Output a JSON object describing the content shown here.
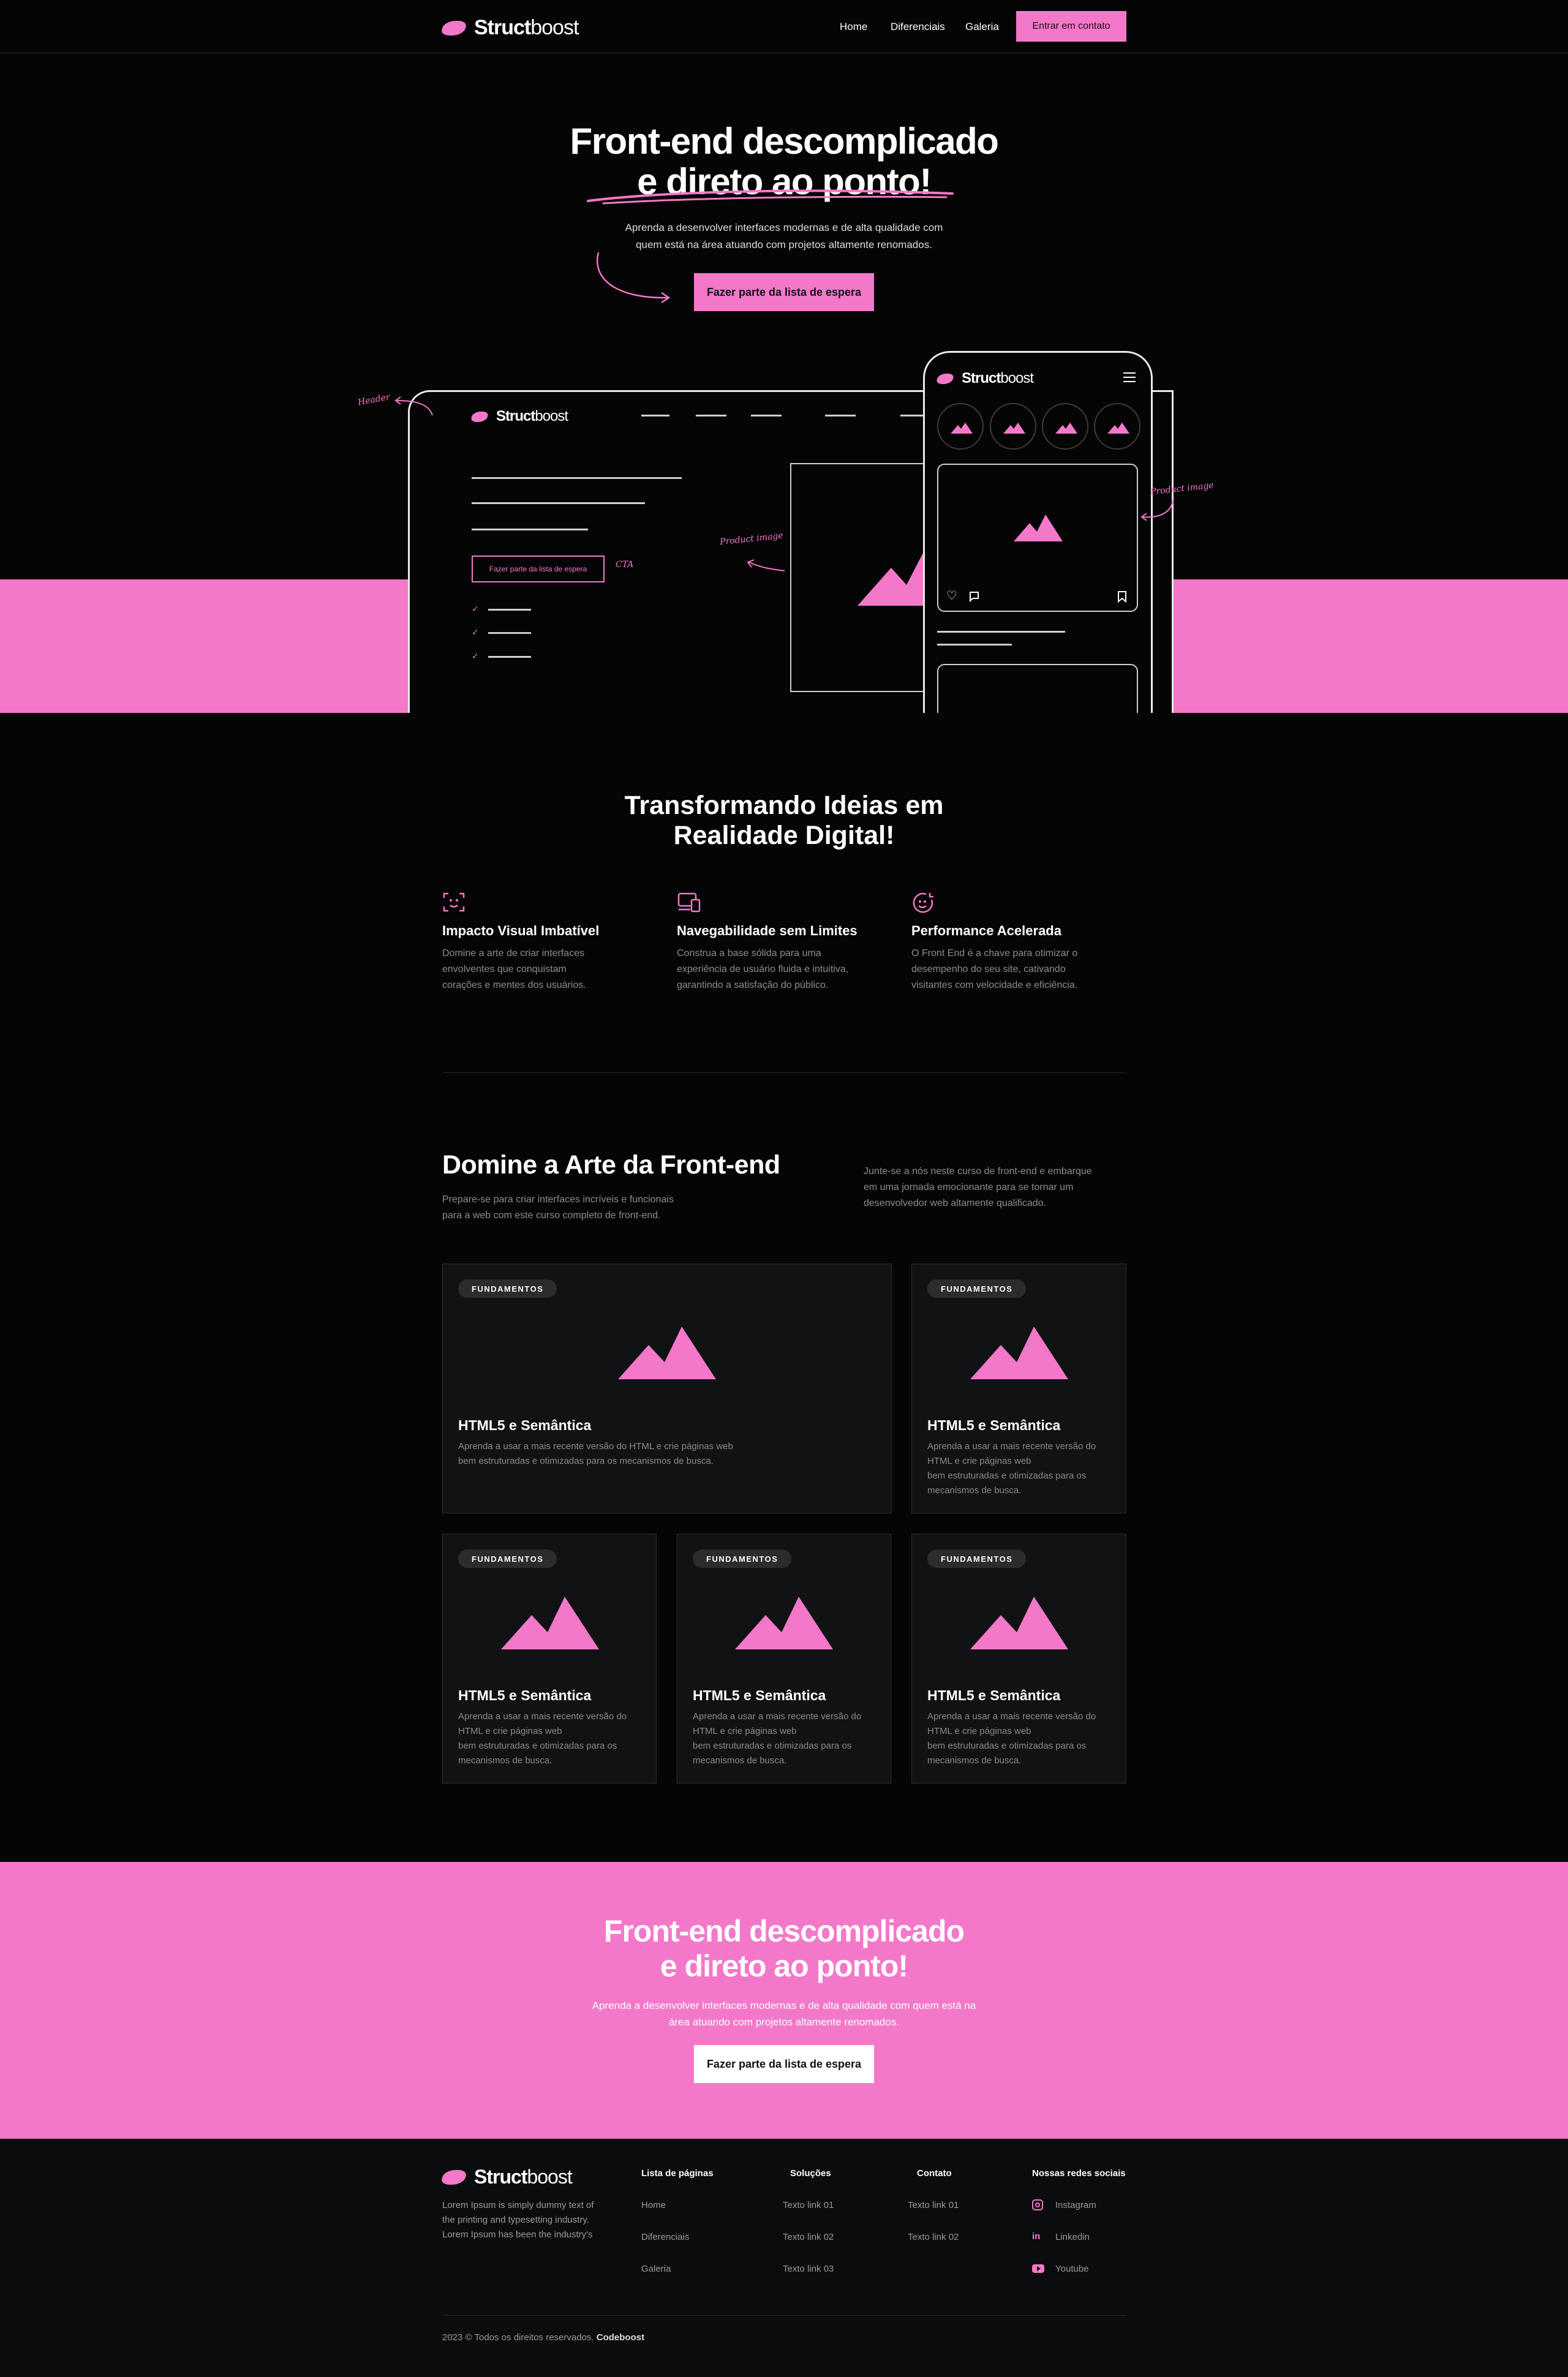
{
  "nav": {
    "logo_bold": "Struct",
    "logo_light": "boost",
    "links": [
      "Home",
      "Diferenciais",
      "Galeria"
    ],
    "cta": "Entrar em contato"
  },
  "hero": {
    "title_line1": "Front-end descomplicado",
    "title_line2": "e direto ao ponto!",
    "subtitle_line1": "Aprenda a desenvolver interfaces modernas e de alta qualidade com",
    "subtitle_line2": "quem está na área atuando com projetos altamente renomados.",
    "cta": "Fazer parte da lista de espera"
  },
  "mockup": {
    "logo_bold": "Struct",
    "logo_light": "boost",
    "cta": "Fazer parte da lista de espera",
    "notes": {
      "header": "Header",
      "cta": "CTA",
      "product_image_left": "Product image",
      "product_image_right": "Product image"
    }
  },
  "features": {
    "title_line1": "Transformando Ideias em",
    "title_line2": "Realidade Digital!",
    "items": [
      {
        "icon": "face-scan-icon",
        "title": "Impacto Visual Imbatível",
        "lines": [
          "Domine a arte de criar interfaces",
          "envolventes que conquistam",
          "corações e mentes dos usuários."
        ]
      },
      {
        "icon": "devices-icon",
        "title": "Navegabilidade sem Limites",
        "lines": [
          "Construa a base sólida para uma",
          "experiência de usuário fluida e intuitiva,",
          "garantindo a satisfação do público."
        ]
      },
      {
        "icon": "speed-icon",
        "title": "Performance Acelerada",
        "lines": [
          "O Front End é a chave para otimizar o",
          "desempenho do seu site, cativando",
          "visitantes com velocidade e eficiência."
        ]
      }
    ]
  },
  "course": {
    "title": "Domine a Arte da Front-end",
    "sub_line1": "Prepare-se para criar interfaces incríveis e funcionais",
    "sub_line2": "para a web com este curso completo de front-end.",
    "side_line1": "Junte-se a nós neste curso de front-end e embarque",
    "side_line2": "em uma jornada emocionante para se tornar um",
    "side_line3": "desenvolvedor web altamente qualificado.",
    "cards": [
      {
        "badge": "FUNDAMENTOS",
        "title": "HTML5 e Semântica",
        "lines": [
          "Aprenda a usar a mais recente versão do HTML e crie páginas web",
          "bem estruturadas e otimizadas para os mecanismos de busca."
        ]
      },
      {
        "badge": "FUNDAMENTOS",
        "title": "HTML5 e Semântica",
        "lines": [
          "Aprenda a usar a mais recente versão do",
          "HTML e crie páginas web",
          "bem estruturadas e otimizadas para os",
          "mecanismos de busca."
        ]
      },
      {
        "badge": "FUNDAMENTOS",
        "title": "HTML5 e Semântica",
        "lines": [
          "Aprenda a usar a mais recente versão do",
          "HTML e crie páginas web",
          "bem estruturadas e otimizadas para os",
          "mecanismos de busca."
        ]
      },
      {
        "badge": "FUNDAMENTOS",
        "title": "HTML5 e Semântica",
        "lines": [
          "Aprenda a usar a mais recente versão do",
          "HTML e crie páginas web",
          "bem estruturadas e otimizadas para os",
          "mecanismos de busca."
        ]
      },
      {
        "badge": "FUNDAMENTOS",
        "title": "HTML5 e Semântica",
        "lines": [
          "Aprenda a usar a mais recente versão do",
          "HTML e crie páginas web",
          "bem estruturadas e otimizadas para os",
          "mecanismos de busca."
        ]
      }
    ]
  },
  "cta": {
    "title_line1": "Front-end descomplicado",
    "title_line2": "e direto ao ponto!",
    "sub_line1": "Aprenda a desenvolver interfaces modernas e de alta qualidade com quem está na",
    "sub_line2": "área atuando com projetos altamente renomados.",
    "button": "Fazer parte da lista de espera"
  },
  "footer": {
    "logo_bold": "Struct",
    "logo_light": "boost",
    "about_line1": "Lorem Ipsum is simply dummy text of",
    "about_line2": "the printing and typesetting industry.",
    "about_line3": "Lorem Ipsum has been the industry's",
    "cols": [
      {
        "title": "Lista de páginas",
        "links": [
          "Home",
          "Diferenciais",
          "Galeria"
        ]
      },
      {
        "title": "Soluções",
        "links": [
          "Texto link 01",
          "Texto link 02",
          "Texto link 03"
        ]
      },
      {
        "title": "Contato",
        "links": [
          "Texto link 01",
          "Texto link 02"
        ]
      }
    ],
    "social_title": "Nossas redes sociais",
    "social": [
      {
        "icon": "instagram-icon",
        "label": "Instagram"
      },
      {
        "icon": "linkedin-icon",
        "label": "Linkedin"
      },
      {
        "icon": "youtube-icon",
        "label": "Youtube"
      }
    ],
    "copyright": "2023 © Todos os direitos reservados.",
    "brand": "Codeboost"
  },
  "colors": {
    "accent": "#f478c9",
    "background": "#050505",
    "card": "#111214"
  }
}
